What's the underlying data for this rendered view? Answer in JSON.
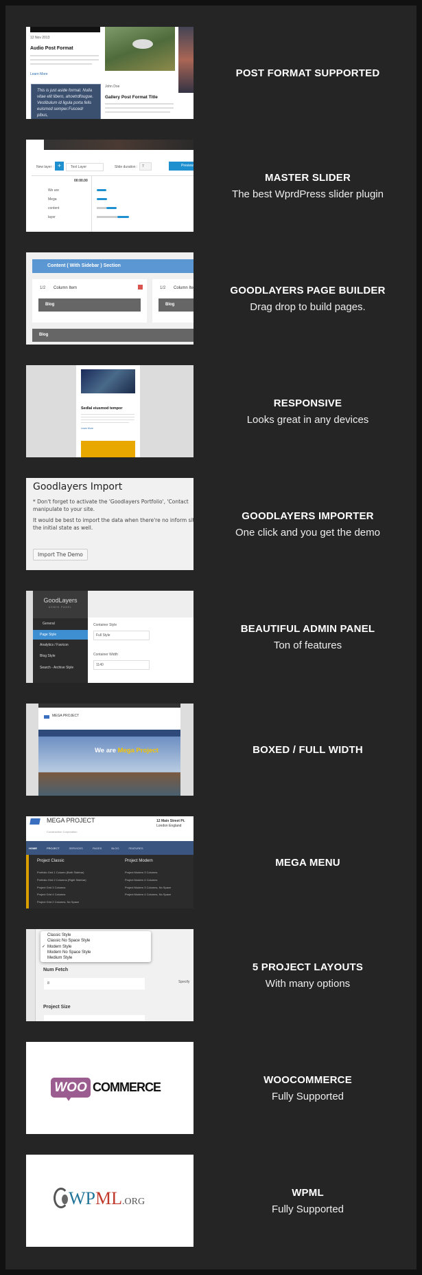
{
  "features": [
    {
      "title": "POST FORMAT SUPPORTED",
      "subtitle": "",
      "thumb": {
        "audio_title": "Audio Post Format",
        "learn_more": "Learn More",
        "aside_text": "This is just aside format. Nulla vitae elit libero, ahoetrdfougue. Vestibulum id ligula porta felis euismod semper.Fuscedr pibus,",
        "gallery_title": "Gallery Post Format Title",
        "date": "12 Nov 2013",
        "author": "John Doe"
      }
    },
    {
      "title": "MASTER SLIDER",
      "subtitle": "The best WprdPress slider plugin",
      "thumb": {
        "new_layer": "New layer :",
        "layer_type": "Text Layer",
        "slide_duration": "Slide duration :",
        "duration_value": "7",
        "preview": "Preview",
        "time": "00:00.00",
        "layers": [
          "We are",
          "Mega",
          "content",
          "layer"
        ]
      }
    },
    {
      "title": "GOODLAYERS PAGE BUILDER",
      "subtitle": "Drag drop to build pages.",
      "thumb": {
        "section": "Content ( With Sidebar ) Section",
        "fraction": "1/2",
        "column_item": "Column Item",
        "blog": "Blog"
      }
    },
    {
      "title": "RESPONSIVE",
      "subtitle": "Looks great in any devices",
      "thumb": {
        "post_title": "Sedlal eiusmod tempor",
        "learn_more": "Learn More"
      }
    },
    {
      "title": "GOODLAYERS IMPORTER",
      "subtitle": "One click and you get the demo",
      "thumb": {
        "heading": "Goodlayers Import",
        "p1": "* Don't forget to activate the 'Goodlayers Portfolio', 'Contact manipulate to your site.",
        "p2": "It would be best to import the data when there're no inform site to the initial state as well.",
        "button": "Import The Demo"
      }
    },
    {
      "title": "BEAUTIFUL ADMIN PANEL",
      "subtitle": "Ton of features",
      "thumb": {
        "brand": "GoodLayers",
        "brand_sub": "ADMIN PANEL",
        "menu": [
          "General",
          "Page Style",
          "Analytics / Favicon",
          "Blog Style",
          "Search - Archive Style"
        ],
        "active_menu": "Page Style",
        "field1_label": "Container Style",
        "field1_value": "Full Style",
        "field2_label": "Container Width",
        "field2_value": "1140",
        "accent": "#3d8fd1"
      }
    },
    {
      "title": "BOXED / FULL WIDTH",
      "subtitle": "",
      "thumb": {
        "logo": "MEGA PROJECT",
        "hero_white": "We are",
        "hero_yellow": "Mega Project"
      }
    },
    {
      "title": "MEGA MENU",
      "subtitle": "",
      "thumb": {
        "logo": "MEGA PROJECT",
        "logo_sub": "Construction Corporation",
        "address1": "12 Main Street Pt.",
        "address2": "London England",
        "nav": [
          "HOME",
          "PROJECT",
          "SERVICES",
          "PAGES",
          "BLOG",
          "FEATURES"
        ],
        "col1_title": "Project Classic",
        "col1": [
          "Portfolio Grid 1 Column (Both Sidebar)",
          "Portfolio Grid 2 Columns (Right Sidebar)",
          "Project Grid 3 Columns",
          "Project Grid 4 Columns",
          "Project Grid 2 Columns, No Space"
        ],
        "col2_title": "Project Modern",
        "col2": [
          "Project Modern 3 Columns",
          "Project Modern 4 Columns",
          "Project Modern 3 Columns, No Space",
          "Project Modern 4 Columns, No Space"
        ]
      }
    },
    {
      "title": "5 PROJECT LAYOUTS",
      "subtitle": "With many options",
      "thumb": {
        "options": [
          "Classic Style",
          "Classic No Space Style",
          "Modern Style",
          "Modern No Space Style",
          "Medium Style"
        ],
        "selected": "Modern Style",
        "num_fetch_label": "Num Fetch",
        "num_fetch_value": "8",
        "specify": "Specify",
        "project_size_label": "Project Size"
      }
    },
    {
      "title": "WOOCOMMERCE",
      "subtitle": "Fully Supported",
      "thumb": {
        "logo_a": "WOO",
        "logo_b": "COMMERCE",
        "brand_color": "#9b5c8f"
      }
    },
    {
      "title": "WPML",
      "subtitle": "Fully Supported",
      "thumb": {
        "logo_a": "WPML",
        ".org": ".ORG",
        "logo_b": ".ORG",
        "color_wp": "#21759b",
        "color_ml": "#c0392b"
      }
    }
  ]
}
